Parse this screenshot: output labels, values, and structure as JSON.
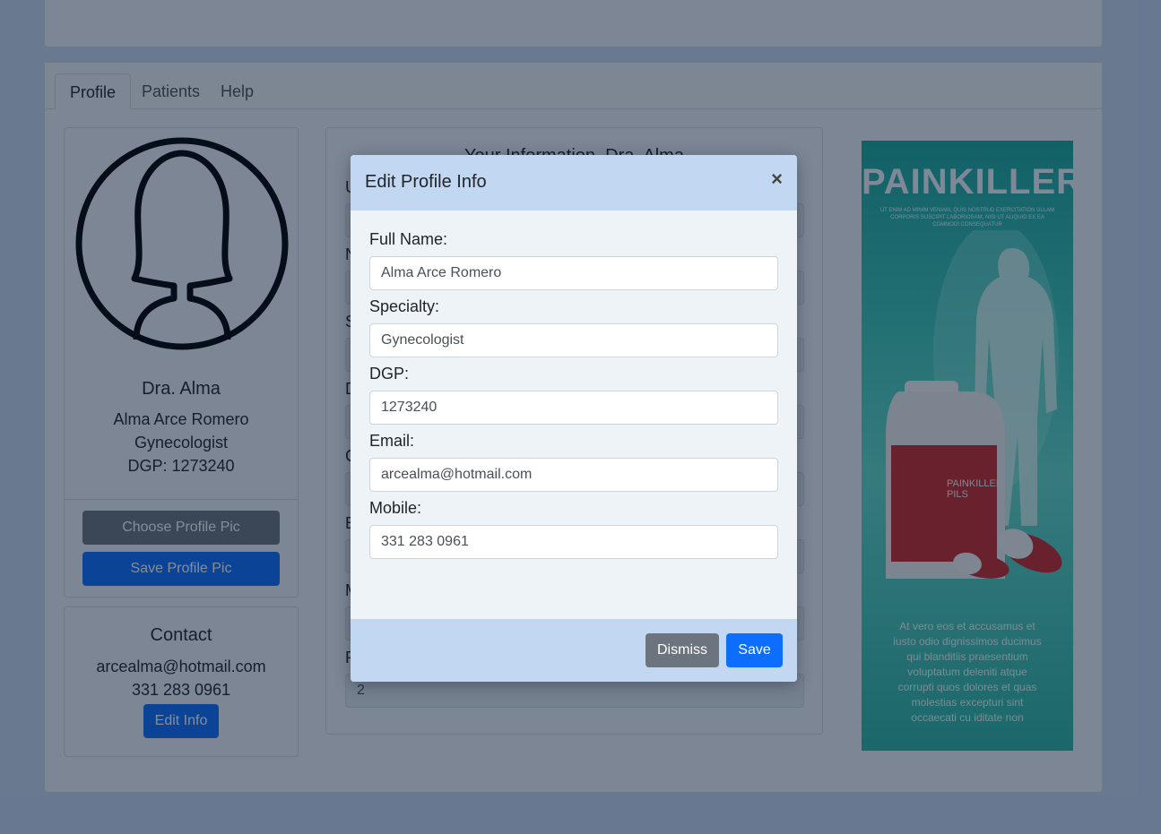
{
  "tabs": [
    "Profile",
    "Patients",
    "Help"
  ],
  "profile": {
    "display_name": "Dra. Alma",
    "full_name": "Alma Arce Romero",
    "specialty": "Gynecologist",
    "dgp_line": "DGP: 1273240",
    "choose_pic_label": "Choose Profile Pic",
    "save_pic_label": "Save Profile Pic"
  },
  "contact": {
    "title": "Contact",
    "email": "arcealma@hotmail.com",
    "phone": "331 283 0961",
    "edit_label": "Edit Info"
  },
  "info": {
    "title": "Your Information, Dra. Alma",
    "letters": [
      "U",
      "N",
      "S",
      "D",
      "C",
      "E",
      "M",
      "P"
    ],
    "last_value": "2"
  },
  "ad": {
    "title": "PAINKILLER",
    "small_text": "UT ENIM AD MINIM VENIAM, QUIS NOSTRUD EXERCITATION ULLAM CORPORIS SUSCIPIT LABORIOSAM, NISI UT ALIQUID EX EA COMMODI CONSEQUATUR",
    "bottle_label_1": "PAINKILLER",
    "bottle_label_2": "PILS",
    "body_text": "At vero eos et accusamus et iusto odio dignissimos ducimus qui blanditiis praesentium voluptatum deleniti atque corrupti quos dolores et quas molestias excepturi sint occaecati cu   iditate non"
  },
  "modal": {
    "title": "Edit Profile Info",
    "close_symbol": "×",
    "labels": {
      "full_name": "Full Name:",
      "specialty": "Specialty:",
      "dgp": "DGP:",
      "email": "Email:",
      "mobile": "Mobile:"
    },
    "values": {
      "full_name": "Alma Arce Romero",
      "specialty": "Gynecologist",
      "dgp": "1273240",
      "email": "arcealma@hotmail.com",
      "mobile": "331 283 0961"
    },
    "dismiss_label": "Dismiss",
    "save_label": "Save"
  },
  "colors": {
    "primary": "#0d6efd",
    "secondary": "#6c757d",
    "modal_header": "#c2d7f2"
  }
}
